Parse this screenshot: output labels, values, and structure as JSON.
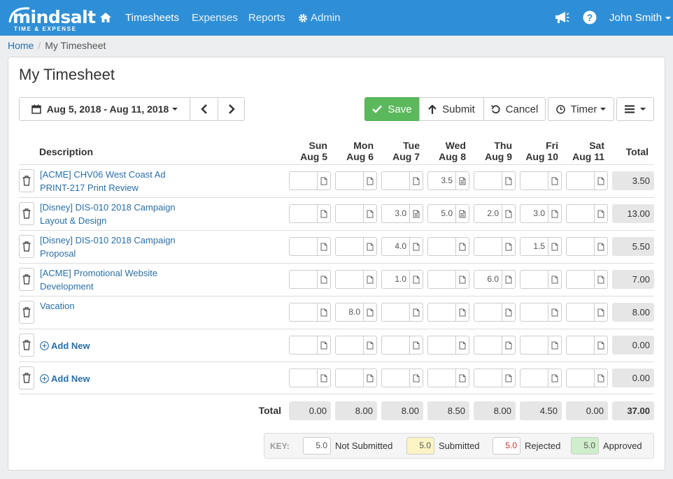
{
  "nav": {
    "brand": "mindsalt",
    "tagline": "TIME & EXPENSE",
    "items": [
      "Timesheets",
      "Expenses",
      "Reports",
      "Admin"
    ],
    "user": "John Smith"
  },
  "breadcrumb": {
    "home": "Home",
    "sep": "/",
    "current": "My Timesheet"
  },
  "page": {
    "title": "My Timesheet"
  },
  "toolbar": {
    "date_range": "Aug 5, 2018 - Aug 11, 2018",
    "save": "Save",
    "submit": "Submit",
    "cancel": "Cancel",
    "timer": "Timer"
  },
  "table": {
    "description_header": "Description",
    "days": [
      {
        "dow": "Sun",
        "date": "Aug 5"
      },
      {
        "dow": "Mon",
        "date": "Aug 6"
      },
      {
        "dow": "Tue",
        "date": "Aug 7"
      },
      {
        "dow": "Wed",
        "date": "Aug 8"
      },
      {
        "dow": "Thu",
        "date": "Aug 9"
      },
      {
        "dow": "Fri",
        "date": "Aug 10"
      },
      {
        "dow": "Sat",
        "date": "Aug 11"
      }
    ],
    "total_header": "Total",
    "rows": [
      {
        "line1": "[ACME] CHV06 West Coast Ad",
        "line2": "PRINT-217 Print Review",
        "values": [
          "",
          "",
          "",
          "3.5",
          "",
          "",
          ""
        ],
        "notes": [
          false,
          false,
          false,
          true,
          false,
          false,
          false
        ],
        "total": "3.50"
      },
      {
        "line1": "[Disney] DIS-010 2018 Campaign",
        "line2": "Layout & Design",
        "values": [
          "",
          "",
          "3.0",
          "5.0",
          "2.0",
          "3.0",
          ""
        ],
        "notes": [
          false,
          false,
          true,
          true,
          false,
          false,
          false
        ],
        "total": "13.00"
      },
      {
        "line1": "[Disney] DIS-010 2018 Campaign",
        "line2": "Proposal",
        "values": [
          "",
          "",
          "4.0",
          "",
          "",
          "1.5",
          ""
        ],
        "notes": [
          false,
          false,
          false,
          false,
          false,
          false,
          false
        ],
        "total": "5.50"
      },
      {
        "line1": "[ACME] Promotional Website",
        "line2": "Development",
        "values": [
          "",
          "",
          "1.0",
          "",
          "6.0",
          "",
          ""
        ],
        "notes": [
          false,
          false,
          false,
          false,
          false,
          false,
          false
        ],
        "total": "7.00"
      },
      {
        "line1": "Vacation",
        "line2": "",
        "values": [
          "",
          "8.0",
          "",
          "",
          "",
          "",
          ""
        ],
        "notes": [
          false,
          false,
          false,
          false,
          false,
          false,
          false
        ],
        "total": "8.00"
      },
      {
        "add_new": "Add New",
        "values": [
          "",
          "",
          "",
          "",
          "",
          "",
          ""
        ],
        "notes": [
          false,
          false,
          false,
          false,
          false,
          false,
          false
        ],
        "total": "0.00"
      },
      {
        "add_new": "Add New",
        "values": [
          "",
          "",
          "",
          "",
          "",
          "",
          ""
        ],
        "notes": [
          false,
          false,
          false,
          false,
          false,
          false,
          false
        ],
        "total": "0.00"
      }
    ],
    "totals_label": "Total",
    "totals": [
      "0.00",
      "8.00",
      "8.00",
      "8.50",
      "8.00",
      "4.50",
      "0.00"
    ],
    "grand_total": "37.00"
  },
  "key": {
    "label": "KEY:",
    "sample": "5.0",
    "items": [
      "Not Submitted",
      "Submitted",
      "Rejected",
      "Approved"
    ],
    "colors": {
      "submitted": "#fcf3c4",
      "rejected_text": "#c9302c",
      "approved": "#cfeecb"
    }
  }
}
